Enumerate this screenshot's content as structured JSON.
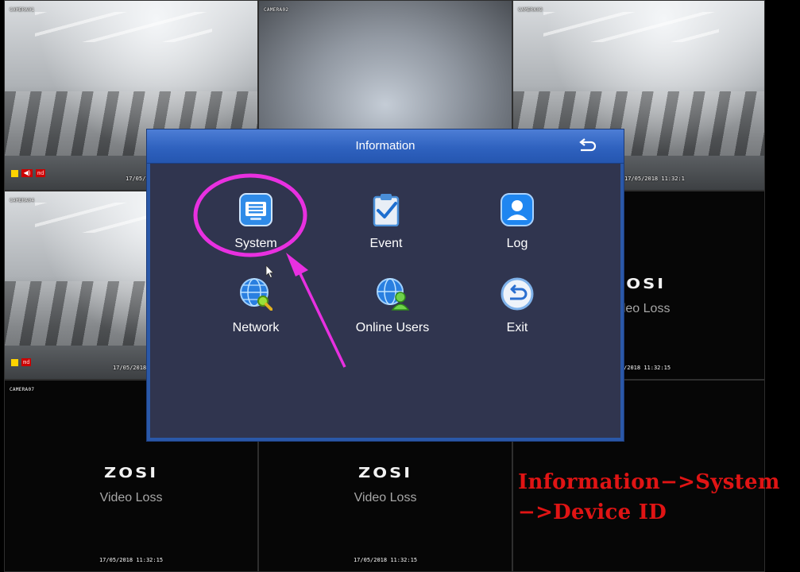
{
  "cameras": [
    {
      "id": "cam1",
      "label": "CAMERA01",
      "timestamp": "17/05/2018",
      "status": {
        "record": true,
        "audio": true,
        "md": "md"
      }
    },
    {
      "id": "cam2",
      "label": "CAMERA02"
    },
    {
      "id": "cam3",
      "label": "CAMERA03",
      "timestamp": "17/05/2018 11:32:1"
    },
    {
      "id": "cam4",
      "label": "CAMERA04",
      "timestamp": "17/05/2018",
      "status": {
        "record": true,
        "md": "md"
      }
    },
    {
      "id": "cam6",
      "logo": "ZOSI",
      "message": "Video Loss",
      "timestamp": "17/05/2018 11:32:15"
    },
    {
      "id": "cam7",
      "label": "CAMERA07",
      "logo": "ZOSI",
      "message": "Video Loss",
      "timestamp": "17/05/2018 11:32:15"
    },
    {
      "id": "cam8",
      "logo": "ZOSI",
      "message": "Video Loss",
      "timestamp": "17/05/2018 11:32:15"
    }
  ],
  "dialog": {
    "title": "Information",
    "back_icon": "return-arrow-icon",
    "items": [
      {
        "label": "System",
        "icon": "system-info-icon",
        "highlighted": true
      },
      {
        "label": "Event",
        "icon": "clipboard-check-icon"
      },
      {
        "label": "Log",
        "icon": "user-log-icon"
      },
      {
        "label": "Network",
        "icon": "network-globe-icon"
      },
      {
        "label": "Online Users",
        "icon": "online-users-icon"
      },
      {
        "label": "Exit",
        "icon": "exit-return-icon"
      }
    ]
  },
  "annotation": {
    "caption_line1": "Information−>System",
    "caption_line2": "−>Device  ID",
    "highlight_color": "#e830e0",
    "caption_color": "#e01414"
  },
  "colors": {
    "dialog_header": "#2f62bf",
    "dialog_body": "#30354f",
    "dialog_border": "#2a58a8"
  }
}
